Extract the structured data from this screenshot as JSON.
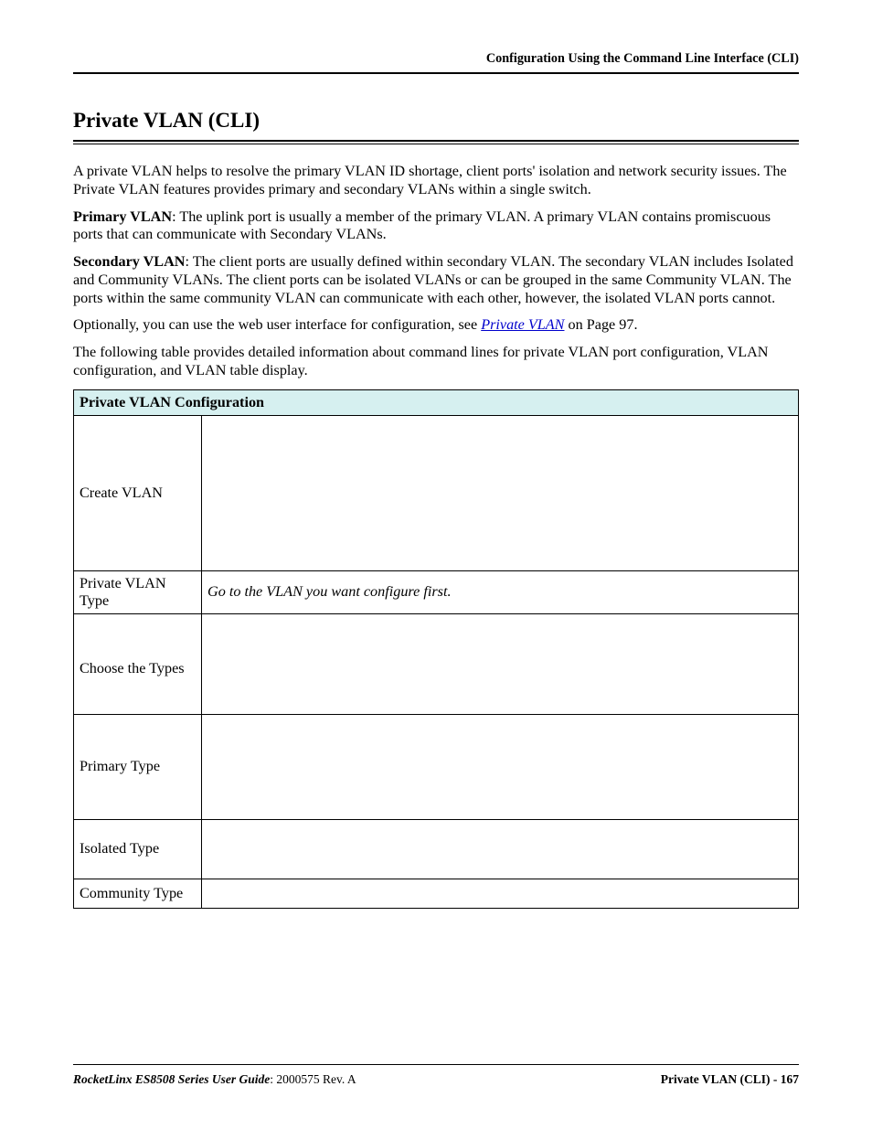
{
  "header": {
    "running_head": "Configuration Using the Command Line Interface (CLI)"
  },
  "title": "Private VLAN (CLI)",
  "paragraphs": {
    "intro": "A private VLAN helps to resolve the primary VLAN ID shortage, client ports' isolation and network security issues. The Private VLAN features provides primary and secondary VLANs within a single switch.",
    "primary_bold": "Primary VLAN",
    "primary_rest": ": The uplink port is usually a member of the primary VLAN. A primary VLAN contains promiscuous ports that can communicate with Secondary VLANs.",
    "secondary_bold": "Secondary VLAN",
    "secondary_rest": ": The client ports are usually defined within secondary VLAN. The secondary VLAN includes Isolated and Community VLANs. The client ports can be isolated VLANs or can be grouped in the same Community VLAN. The ports within the same community VLAN can communicate with each other, however, the isolated VLAN ports cannot.",
    "optional_pre": "Optionally, you can use the web user interface for configuration, see ",
    "optional_link": "Private VLAN",
    "optional_post": " on Page 97.",
    "following": "The following table provides detailed information about command lines for private VLAN port configuration, VLAN configuration, and VLAN table display."
  },
  "table": {
    "header": "Private VLAN Configuration",
    "rows": {
      "r1_left": "Create VLAN",
      "r1_right": "",
      "r2_left": "Private VLAN Type",
      "r2_right": "Go to the VLAN you want configure first.",
      "r3_left": "Choose the Types",
      "r3_right": "",
      "r4_left": "Primary Type",
      "r4_right": "",
      "r5_left": "Isolated Type",
      "r5_right": "",
      "r6_left": "Community Type",
      "r6_right": ""
    }
  },
  "footer": {
    "left_italic": "RocketLinx ES8508 Series  User Guide",
    "left_rest": ": 2000575 Rev. A",
    "right": "Private VLAN (CLI) - 167"
  }
}
